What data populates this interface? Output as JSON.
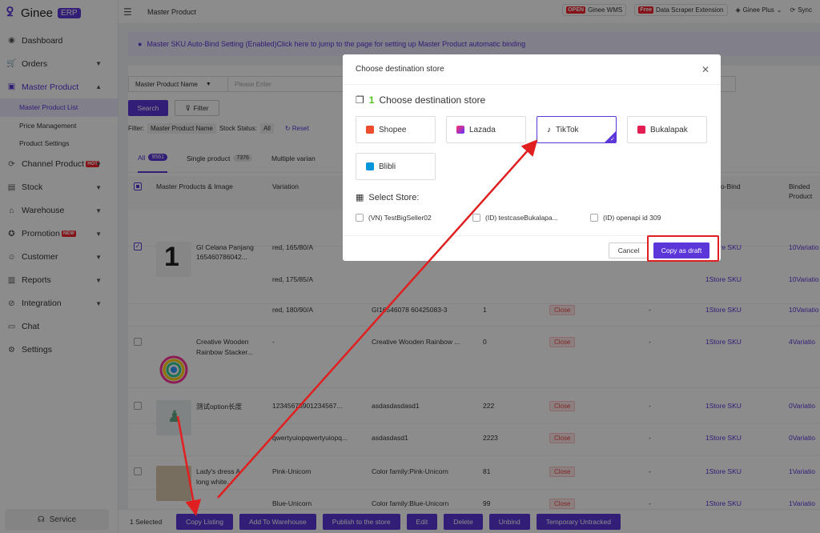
{
  "app": {
    "logo_text": "Ginee",
    "logo_badge": "ERP"
  },
  "sidebar": {
    "items": [
      {
        "label": "Dashboard",
        "icon": "dashboard-icon"
      },
      {
        "label": "Orders",
        "icon": "cart-icon"
      },
      {
        "label": "Master Product",
        "icon": "bag-icon"
      },
      {
        "label": "Channel Product",
        "icon": "sync-icon",
        "badge": "HOT"
      },
      {
        "label": "Stock",
        "icon": "box-icon"
      },
      {
        "label": "Warehouse",
        "icon": "warehouse-icon"
      },
      {
        "label": "Promotion",
        "icon": "tag-icon",
        "badge": "NEW"
      },
      {
        "label": "Customer",
        "icon": "users-icon"
      },
      {
        "label": "Reports",
        "icon": "chart-icon"
      },
      {
        "label": "Integration",
        "icon": "link-icon"
      },
      {
        "label": "Chat",
        "icon": "chat-icon"
      },
      {
        "label": "Settings",
        "icon": "gear-icon"
      }
    ],
    "sub_items": [
      "Master Product List",
      "Price Management",
      "Product Settings"
    ],
    "service": "Service"
  },
  "topbar": {
    "breadcrumb": "Master Product",
    "wms_tag": "OPEN",
    "wms_label": "Ginee WMS",
    "scraper_tag": "Free",
    "scraper_label": "Data Scraper Extension",
    "plus_label": "Ginee Plus",
    "sync_label": "Sync"
  },
  "notice": "Master SKU Auto-Bind Setting (Enabled)Click here to jump to the page for setting up Master Product automatic binding",
  "filters": {
    "field_select": "Master Product Name",
    "input_placeholder": "Please Enter",
    "search": "Search",
    "filter": "Filter",
    "filter_label": "Filter:",
    "chip_1": "Master Product Name",
    "status_label": "Stock Status:",
    "chip_2": "All",
    "reset": "Reset"
  },
  "tabs": [
    {
      "label": "All",
      "count": "9561"
    },
    {
      "label": "Single product",
      "count": "7376"
    },
    {
      "label": "Multiple varian"
    }
  ],
  "table": {
    "headers": {
      "product": "Master Products & Image",
      "variation": "Variation",
      "bind": "o-Bind",
      "binded_1": "Binded",
      "binded_2": "Product"
    },
    "rows": [
      {
        "name1": "GI Celana Panjang",
        "name2": "165460786042...",
        "variation": "red, 165/80/A",
        "sku": "",
        "stock": "",
        "status": "",
        "dash": "",
        "bind": "1Store SKU",
        "binded": "10Variatio"
      },
      {
        "name1": "",
        "name2": "",
        "variation": "red, 175/85/A",
        "sku": "",
        "stock": "",
        "status": "",
        "dash": "",
        "bind": "1Store SKU",
        "binded": "10Variatio"
      },
      {
        "name1": "",
        "name2": "",
        "variation": "red, 180/90/A",
        "sku": "GI16546078 60425083-3",
        "stock": "1",
        "status": "Close",
        "dash": "-",
        "bind": "1Store SKU",
        "binded": "10Variatio"
      },
      {
        "name1": "Creative Wooden",
        "name2": "Rainbow Stacker...",
        "variation": "-",
        "sku": "Creative Wooden Rainbow ...",
        "stock": "0",
        "status": "Close",
        "dash": "-",
        "bind": "1Store SKU",
        "binded": "4Variatio"
      },
      {
        "name1": "测试option长度",
        "name2": "",
        "variation": "12345678901234567...",
        "sku": "asdasdasdasd1",
        "stock": "222",
        "status": "Close",
        "dash": "-",
        "bind": "1Store SKU",
        "binded": "0Variatio"
      },
      {
        "name1": "",
        "name2": "",
        "variation": "qwertyuiopqwertyuiopq...",
        "sku": "asdasdasd1",
        "stock": "2223",
        "status": "Close",
        "dash": "-",
        "bind": "1Store SKU",
        "binded": "0Variatio"
      },
      {
        "name1": "Lady's dress A",
        "name2": "long white...",
        "variation": "Pink-Unicorn",
        "sku": "Color family:Pink-Unicorn",
        "stock": "81",
        "status": "Close",
        "dash": "-",
        "bind": "1Store SKU",
        "binded": "1Variatio"
      },
      {
        "name1": "",
        "name2": "",
        "variation": "Blue-Unicorn",
        "sku": "Color family:Blue-Unicorn",
        "stock": "99",
        "status": "Close",
        "dash": "-",
        "bind": "1Store SKU",
        "binded": "1Variatio"
      }
    ]
  },
  "actionbar": {
    "selected": "1 Selected",
    "buttons": [
      "Copy Listing",
      "Add To Warehouse",
      "Publish to the store",
      "Edit",
      "Delete",
      "Unbind",
      "Temporary Untracked"
    ]
  },
  "modal": {
    "title": "Choose destination store",
    "step_num": "1",
    "step_label": "Choose destination store",
    "stores": [
      {
        "label": "Shopee",
        "color": "#ee4d2d"
      },
      {
        "label": "Lazada",
        "color": "#6a2cdc"
      },
      {
        "label": "TikTok",
        "color": "#111111"
      },
      {
        "label": "Bukalapak",
        "color": "#e31e52"
      },
      {
        "label": "Blibli",
        "color": "#0095da"
      }
    ],
    "select_store_title": "Select Store:",
    "store_options": [
      "(VN) TestBigSeller02",
      "(ID) testcaseBukalapa...",
      "(ID) openapi id 309"
    ],
    "cancel": "Cancel",
    "copy_draft": "Copy as draft"
  },
  "colors": {
    "accent": "#5b36d9",
    "highlight": "#e02020"
  }
}
